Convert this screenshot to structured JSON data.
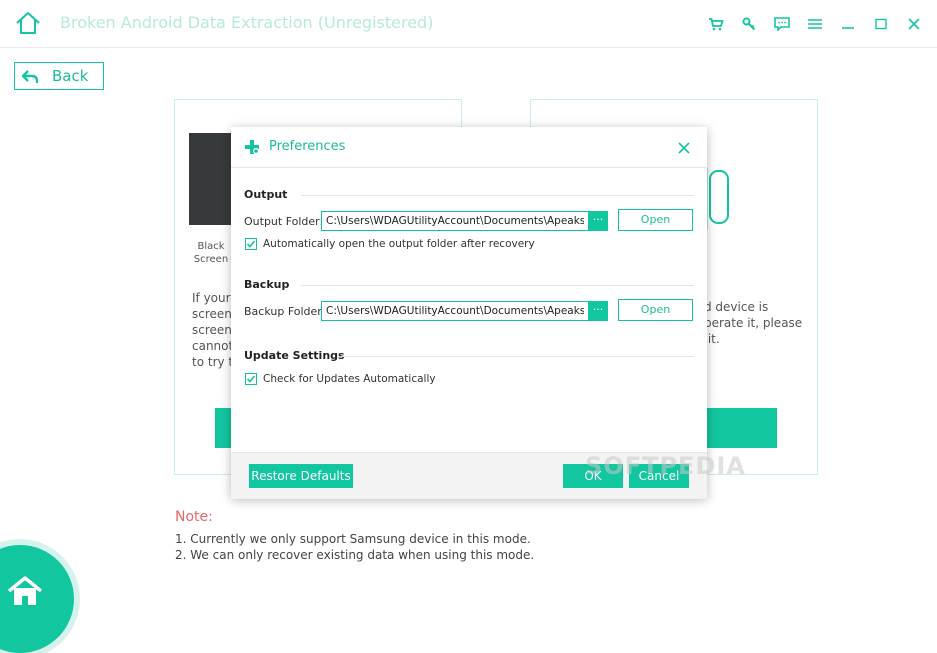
{
  "app": {
    "title": "Broken Android Data Extraction (Unregistered)"
  },
  "toolbar": {
    "icons": [
      "cart-icon",
      "key-icon",
      "feedback-icon",
      "menu-icon",
      "minimize-icon",
      "maximize-icon",
      "close-icon"
    ]
  },
  "back": {
    "label": "Back"
  },
  "left_card": {
    "image_label_1": "Black",
    "image_label_2": "Screen",
    "text": "If your\nscreen\nscreen\ncannot\nto try t"
  },
  "right_card": {
    "text": "d device is\nperate it, please\n it."
  },
  "note": {
    "title": "Note:",
    "line1": "1. Currently we only support Samsung device in this mode.",
    "line2": "2. We can only recover existing data when using this mode."
  },
  "watermark": "SOFTPEDIA",
  "dialog": {
    "title": "Preferences",
    "output": {
      "heading": "Output",
      "folder_label": "Output Folder:",
      "folder_value": "C:\\Users\\WDAGUtilityAccount\\Documents\\Apeaksoft Studio",
      "browse_label": "···",
      "open_label": "Open",
      "auto_open_label": "Automatically open the output folder after recovery",
      "auto_open_checked": true
    },
    "backup": {
      "heading": "Backup",
      "folder_label": "Backup Folder:",
      "folder_value": "C:\\Users\\WDAGUtilityAccount\\Documents\\Apeaksoft Studio",
      "browse_label": "···",
      "open_label": "Open"
    },
    "update": {
      "heading": "Update Settings",
      "check_label": "Check for Updates Automatically",
      "check_checked": true
    },
    "buttons": {
      "restore": "Restore Defaults",
      "ok": "OK",
      "cancel": "Cancel"
    }
  },
  "colors": {
    "accent": "#12c6a0",
    "title_text": "#b9e8dc",
    "note_title": "#e86868"
  }
}
